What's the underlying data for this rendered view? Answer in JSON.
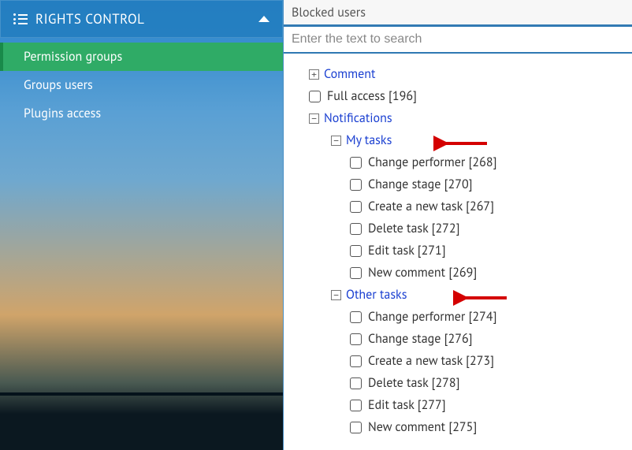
{
  "sidebar": {
    "title": "RIGHTS CONTROL",
    "items": [
      {
        "label": "Permission groups",
        "active": true
      },
      {
        "label": "Groups users",
        "active": false
      },
      {
        "label": "Plugins access",
        "active": false
      }
    ]
  },
  "top": {
    "title": "Blocked users",
    "search_placeholder": "Enter the text to search"
  },
  "tree": {
    "comment": {
      "label": "Comment"
    },
    "full_access": {
      "label": "Full access [196]"
    },
    "notifications": {
      "label": "Notifications"
    },
    "my_tasks": {
      "label": "My tasks",
      "items": [
        "Change performer [268]",
        "Change stage [270]",
        "Create a new task [267]",
        "Delete task [272]",
        "Edit task [271]",
        "New comment [269]"
      ]
    },
    "other_tasks": {
      "label": "Other tasks",
      "items": [
        "Change performer [274]",
        "Change stage [276]",
        "Create a new task [273]",
        "Delete task [278]",
        "Edit task [277]",
        "New comment [275]"
      ]
    }
  }
}
